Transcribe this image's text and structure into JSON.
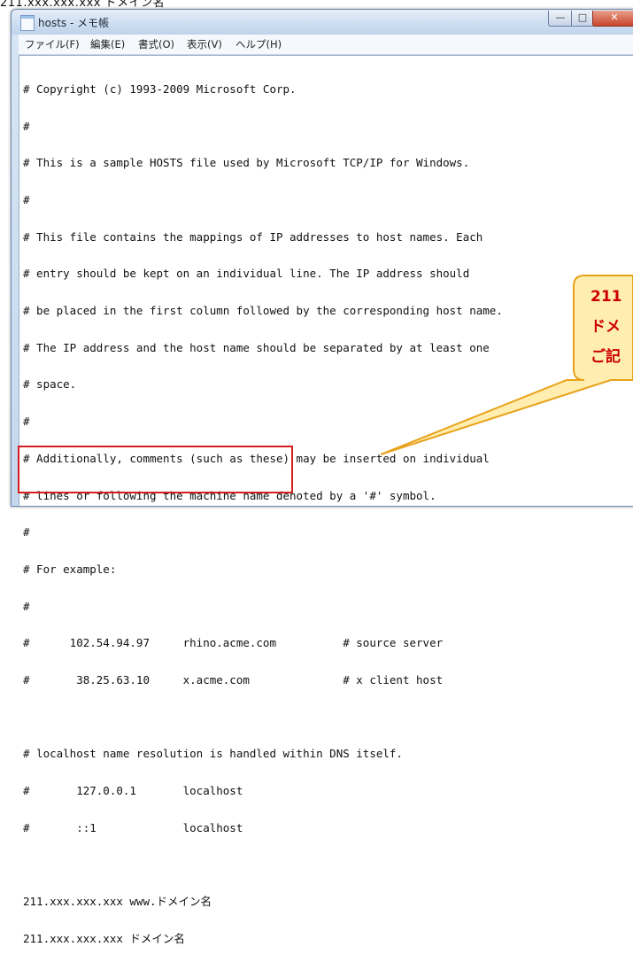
{
  "caption": "211.xxx.xxx.xxx ドメイン名",
  "window": {
    "title": "hosts - メモ帳",
    "controls": {
      "minimize": "—",
      "maximize": "□",
      "close": "✕"
    }
  },
  "menu": [
    {
      "label": "ファイル(F)"
    },
    {
      "label": "編集(E)"
    },
    {
      "label": "書式(O)"
    },
    {
      "label": "表示(V)"
    },
    {
      "label": "ヘルプ(H)"
    }
  ],
  "file_lines": [
    "# Copyright (c) 1993-2009 Microsoft Corp.",
    "#",
    "# This is a sample HOSTS file used by Microsoft TCP/IP for Windows.",
    "#",
    "# This file contains the mappings of IP addresses to host names. Each",
    "# entry should be kept on an individual line. The IP address should",
    "# be placed in the first column followed by the corresponding host name.",
    "# The IP address and the host name should be separated by at least one",
    "# space.",
    "#",
    "# Additionally, comments (such as these) may be inserted on individual",
    "# lines or following the machine name denoted by a '#' symbol.",
    "#",
    "# For example:",
    "#",
    "#      102.54.94.97     rhino.acme.com          # source server",
    "#       38.25.63.10     x.acme.com              # x client host",
    "",
    "# localhost name resolution is handled within DNS itself.",
    "#       127.0.0.1       localhost",
    "#       ::1             localhost",
    "",
    "211.xxx.xxx.xxx www.ドメイン名",
    "211.xxx.xxx.xxx ドメイン名"
  ],
  "callout": {
    "lines": [
      "211",
      "ドメ",
      "ご記"
    ],
    "text_color": "#cc0000",
    "fill_color": "#ffeeb0",
    "border_color": "#e8a21a"
  },
  "highlight_color": "#d61e1e"
}
